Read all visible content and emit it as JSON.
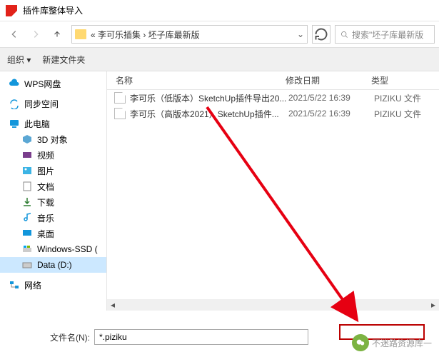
{
  "title": "插件库整体导入",
  "breadcrumb": "« 李可乐插集 › 坯子库最新版",
  "search_placeholder": "搜索\"坯子库最新版",
  "toolbar": {
    "organize": "组织 ▾",
    "newfolder": "新建文件夹"
  },
  "columns": {
    "name": "名称",
    "date": "修改日期",
    "type": "类型"
  },
  "sidebar": {
    "wps": "WPS网盘",
    "sync": "同步空间",
    "thispc": "此电脑",
    "obj3d": "3D 对象",
    "video": "视频",
    "pictures": "图片",
    "documents": "文档",
    "downloads": "下载",
    "music": "音乐",
    "desktop": "桌面",
    "winssd": "Windows-SSD (",
    "datad": "Data (D:)",
    "network": "网络"
  },
  "files": [
    {
      "name": "李可乐（低版本）SketchUp插件导出20...",
      "date": "2021/5/22 16:39",
      "type": "PIZIKU 文件"
    },
    {
      "name": "李可乐（高版本2021）SketchUp插件...",
      "date": "2021/5/22 16:39",
      "type": "PIZIKU 文件"
    }
  ],
  "filename_label": "文件名(N):",
  "filename_value": "*.piziku",
  "watermark": "不迷路资源库一"
}
